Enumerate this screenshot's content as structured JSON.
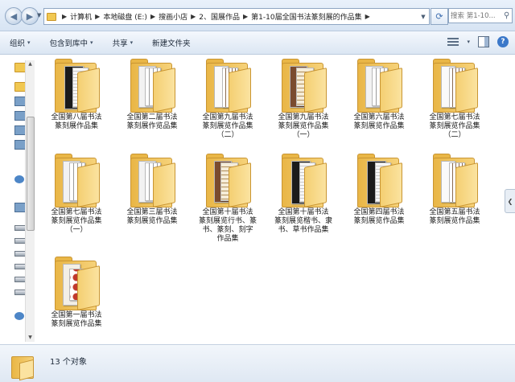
{
  "address": {
    "breadcrumbs": [
      "计算机",
      "本地磁盘 (E:)",
      "搜画小店",
      "2、国展作品",
      "第1-10届全国书法篆刻展的作品集"
    ]
  },
  "search": {
    "placeholder": "搜索 第1-10..."
  },
  "toolbar": {
    "organize": "组织",
    "include_library": "包含到库中",
    "share": "共享",
    "new_folder": "新建文件夹"
  },
  "folders": [
    {
      "name": "全国第八届书法\n篆刻展作品集",
      "thumb": "dark"
    },
    {
      "name": "全国第二届书法\n篆刻展作览品集",
      "thumb": "light"
    },
    {
      "name": "全国第九届书法\n篆刻展览作品集\n（二）",
      "thumb": "scroll"
    },
    {
      "name": "全国第九届书法\n篆刻展览作品集\n（一）",
      "thumb": "grid"
    },
    {
      "name": "全国第六届书法\n篆刻展览作品集",
      "thumb": "light"
    },
    {
      "name": "全国第七届书法\n篆刻展览作品集\n（二）",
      "thumb": "scroll"
    },
    {
      "name": "全国第七届书法\n篆刻展览作品集\n（一）",
      "thumb": "light"
    },
    {
      "name": "全国第三届书法\n篆刻展览作品集",
      "thumb": "light"
    },
    {
      "name": "全国第十届书法\n篆刻展览行书、篆\n书、篆刻、刻字\n作品集",
      "thumb": "grid"
    },
    {
      "name": "全国第十届书法\n篆刻展览楷书、隶\n书、草书作品集",
      "thumb": "dark"
    },
    {
      "name": "全国第四届书法\n篆刻展览作品集",
      "thumb": "dark"
    },
    {
      "name": "全国第五届书法\n篆刻展览作品集",
      "thumb": "scroll"
    },
    {
      "name": "全国第一届书法\n篆刻展览作品集",
      "thumb": "seal"
    }
  ],
  "status": {
    "count_text": "13 个对象"
  },
  "colors": {
    "folder": "#f1c852",
    "accent": "#3b78c9"
  }
}
